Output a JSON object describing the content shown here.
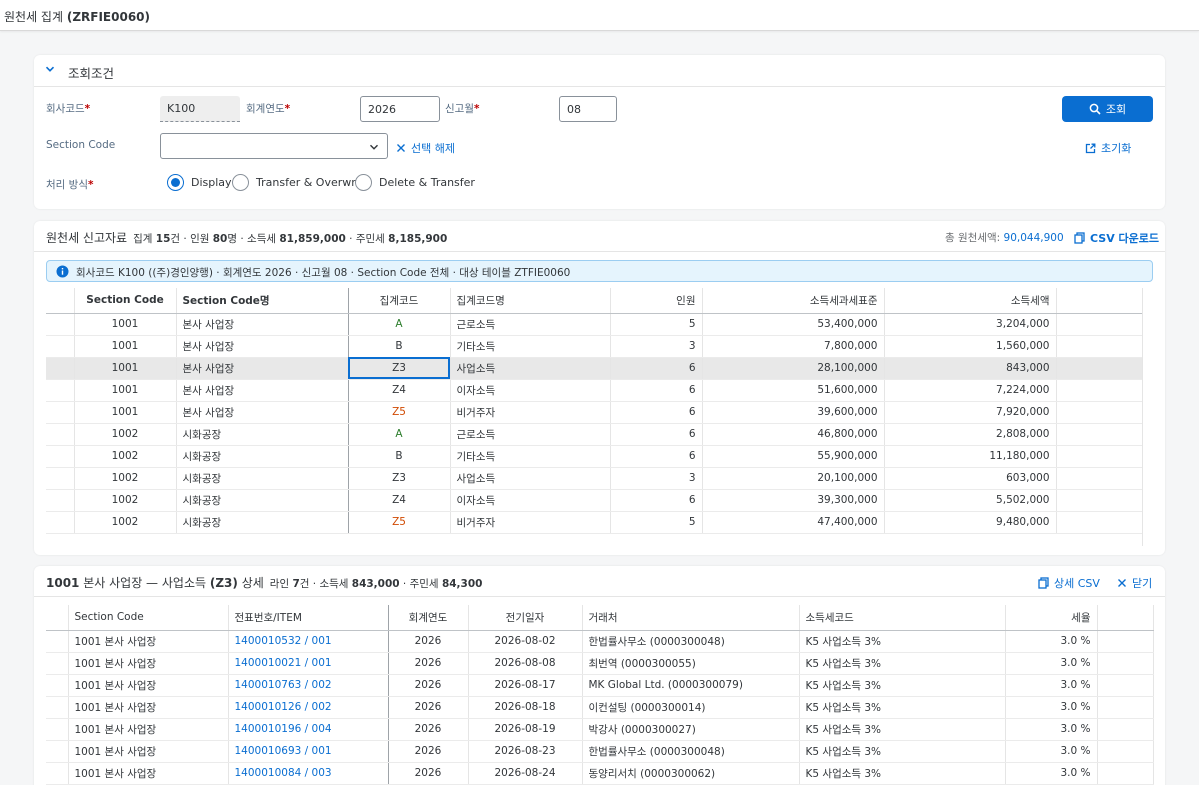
{
  "app": {
    "title_prefix": "원천세 집계 ",
    "title_code": "(ZRFIE0060)"
  },
  "filter": {
    "title": "조회조건",
    "company_label": "회사코드",
    "company_value": "K100",
    "year_label": "회계연도",
    "year_value": "2026",
    "month_label": "신고월",
    "month_value": "08",
    "section_label": "Section Code",
    "section_value": "",
    "clear_label": "선택 해제",
    "search_label": "조회",
    "reset_label": "초기화",
    "mode_label": "처리 방식",
    "modes": [
      "Display",
      "Transfer & Overwrite",
      "Delete & Transfer"
    ],
    "required_mark": "*"
  },
  "main": {
    "title": "원천세 신고자료",
    "sum_pre1": "집계 ",
    "sum_v1": "15",
    "sum_pre2": "건 · 인원 ",
    "sum_v2": "80",
    "sum_pre3": "명 · 소득세 ",
    "sum_v3": "81,859,000",
    "sum_pre4": " · 주민세 ",
    "sum_v4": "8,185,900",
    "total_label": "총 원천세액: ",
    "total_value": "90,044,900",
    "csv_label": "CSV 다운로드",
    "info": "회사코드 K100 ((주)경인양행) · 회계연도 2026 · 신고월 08 · Section Code 전체 · 대상 테이블 ZTFIE0060",
    "columns": [
      "Section Code",
      "Section Code명",
      "집계코드",
      "집계코드명",
      "인원",
      "소득세과세표준",
      "소득세액"
    ],
    "rows": [
      [
        "1001",
        "본사 사업장",
        "A",
        "근로소득",
        "5",
        "53,400,000",
        "3,204,000"
      ],
      [
        "1001",
        "본사 사업장",
        "B",
        "기타소득",
        "3",
        "7,800,000",
        "1,560,000"
      ],
      [
        "1001",
        "본사 사업장",
        "Z3",
        "사업소득",
        "6",
        "28,100,000",
        "843,000"
      ],
      [
        "1001",
        "본사 사업장",
        "Z4",
        "이자소득",
        "6",
        "51,600,000",
        "7,224,000"
      ],
      [
        "1001",
        "본사 사업장",
        "Z5",
        "비거주자",
        "6",
        "39,600,000",
        "7,920,000"
      ],
      [
        "1002",
        "시화공장",
        "A",
        "근로소득",
        "6",
        "46,800,000",
        "2,808,000"
      ],
      [
        "1002",
        "시화공장",
        "B",
        "기타소득",
        "6",
        "55,900,000",
        "11,180,000"
      ],
      [
        "1002",
        "시화공장",
        "Z3",
        "사업소득",
        "3",
        "20,100,000",
        "603,000"
      ],
      [
        "1002",
        "시화공장",
        "Z4",
        "이자소득",
        "6",
        "39,300,000",
        "5,502,000"
      ],
      [
        "1002",
        "시화공장",
        "Z5",
        "비거주자",
        "5",
        "47,400,000",
        "9,480,000"
      ]
    ]
  },
  "detail": {
    "title_code": "1001",
    "title_mid": " 본사 사업장 — 사업소득 ",
    "title_z": "(Z3)",
    "title_end": " 상세",
    "sum_pre1": "라인 ",
    "sum_v1": "7",
    "sum_pre2": "건 · 소득세 ",
    "sum_v2": "843,000",
    "sum_pre3": " · 주민세 ",
    "sum_v3": "84,300",
    "csv_label": "상세 CSV",
    "close_label": "닫기",
    "columns": [
      "Section Code",
      "전표번호/ITEM",
      "회계연도",
      "전기일자",
      "거래처",
      "소득세코드",
      "세율"
    ],
    "rows": [
      [
        "1001 본사 사업장",
        "1400010532 / 001",
        "2026",
        "2026-08-02",
        "한법률사무소 (0000300048)",
        "K5 사업소득 3%",
        "3.0 %"
      ],
      [
        "1001 본사 사업장",
        "1400010021 / 001",
        "2026",
        "2026-08-08",
        "최번역 (0000300055)",
        "K5 사업소득 3%",
        "3.0 %"
      ],
      [
        "1001 본사 사업장",
        "1400010763 / 002",
        "2026",
        "2026-08-17",
        "MK Global Ltd. (0000300079)",
        "K5 사업소득 3%",
        "3.0 %"
      ],
      [
        "1001 본사 사업장",
        "1400010126 / 002",
        "2026",
        "2026-08-18",
        "이컨설팅 (0000300014)",
        "K5 사업소득 3%",
        "3.0 %"
      ],
      [
        "1001 본사 사업장",
        "1400010196 / 004",
        "2026",
        "2026-08-19",
        "박강사 (0000300027)",
        "K5 사업소득 3%",
        "3.0 %"
      ],
      [
        "1001 본사 사업장",
        "1400010693 / 001",
        "2026",
        "2026-08-23",
        "한법률사무소 (0000300048)",
        "K5 사업소득 3%",
        "3.0 %"
      ],
      [
        "1001 본사 사업장",
        "1400010084 / 003",
        "2026",
        "2026-08-24",
        "동양리서치 (0000300062)",
        "K5 사업소득 3%",
        "3.0 %"
      ]
    ]
  }
}
